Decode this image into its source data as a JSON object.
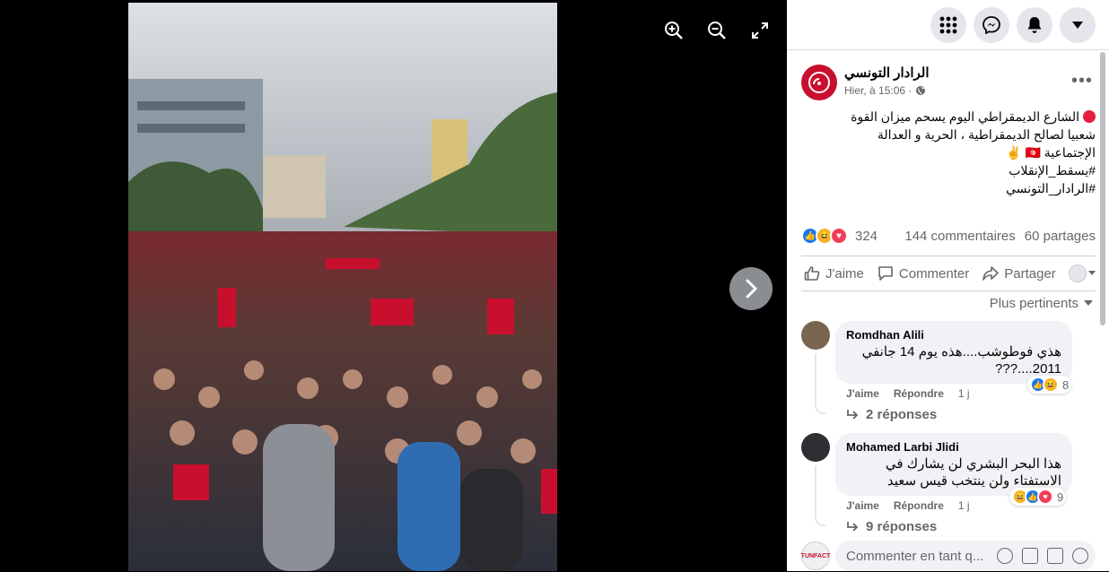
{
  "viewer": {
    "tools": [
      {
        "icon": "zoom-in-icon"
      },
      {
        "icon": "zoom-out-icon"
      },
      {
        "icon": "fullscreen-icon"
      }
    ],
    "next_icon": "chevron-right-icon"
  },
  "topbar": {
    "buttons": [
      {
        "icon": "menu-grid-icon"
      },
      {
        "icon": "messenger-icon"
      },
      {
        "icon": "notifications-bell-icon"
      },
      {
        "icon": "account-caret-icon"
      }
    ]
  },
  "post": {
    "page_name": "الرادار التونسي",
    "time": "Hier, à 15:06 ·",
    "audience_icon": "globe-icon",
    "text_lines": [
      "الشارع الديمقراطي اليوم يسحم ميزان القوة",
      "شعبيا لصالح الديمقراطية ، الحرية و العدالة",
      "الإجتماعية 🇹🇳 ✌",
      "#يسقط_الإنقلاب",
      "#الرادار_التونسي"
    ],
    "reaction_count": "324",
    "comments_count": "144 commentaires",
    "shares_count": "60 partages",
    "actions": {
      "like": "J'aime",
      "comment": "Commenter",
      "share": "Partager"
    },
    "sort_label": "Plus pertinents"
  },
  "comments": [
    {
      "author": "Romdhan Alili",
      "lines": [
        "هذي فوطوشب....هذه يوم 14 جانفي",
        "2011....???"
      ],
      "reaction_count": "8",
      "like": "J'aime",
      "reply": "Répondre",
      "age": "1 j",
      "replies_label": "2 réponses"
    },
    {
      "author": "Mohamed Larbi Jlidi",
      "lines": [
        "هذا البحر البشري لن يشارك في",
        "الاستفتاء ولن ينتخب قيس سعيد"
      ],
      "reaction_count": "9",
      "like": "J'aime",
      "reply": "Répondre",
      "age": "1 j",
      "replies_label": "9 réponses"
    }
  ],
  "composer": {
    "placeholder": "Commenter en tant q...",
    "avatar_label": "TUNFACT",
    "icons": [
      "emoji-icon",
      "camera-icon",
      "gif-icon",
      "sticker-icon"
    ]
  },
  "colors": {
    "accent": "#1877f2",
    "text_secondary": "#65676b",
    "panel_bg": "#ffffff",
    "bubble_bg": "#f0f2f5"
  }
}
